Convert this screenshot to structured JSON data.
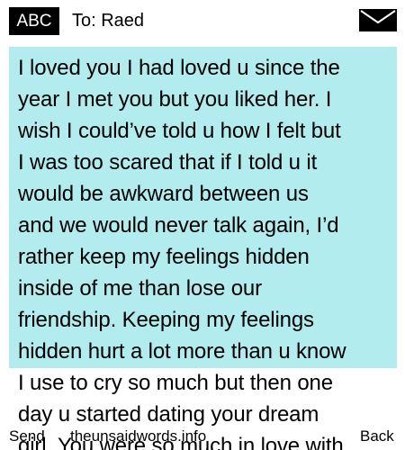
{
  "header": {
    "mode_badge": "ABC",
    "recipient": "To: Raed",
    "envelope_icon": "envelope-icon"
  },
  "message": {
    "lines": [
      "I loved you I had loved u since the",
      "year I met you but you liked her. I",
      "wish I could’ve told u how I felt but",
      "I was too scared that if I told u it",
      "would be awkward between us",
      "and we would never talk again, I’d",
      "rather keep my feelings hidden",
      "inside of me than lose our",
      "friendship. Keeping my feelings",
      "hidden hurt a lot more than u know",
      "I use to cry so much but then one",
      "day u started dating your dream",
      "girl. You were so much in love with"
    ],
    "selection_color": "#b2ecee"
  },
  "softkeys": {
    "left": "Send",
    "center_watermark": "theunsaidwords.info",
    "right": "Back"
  }
}
